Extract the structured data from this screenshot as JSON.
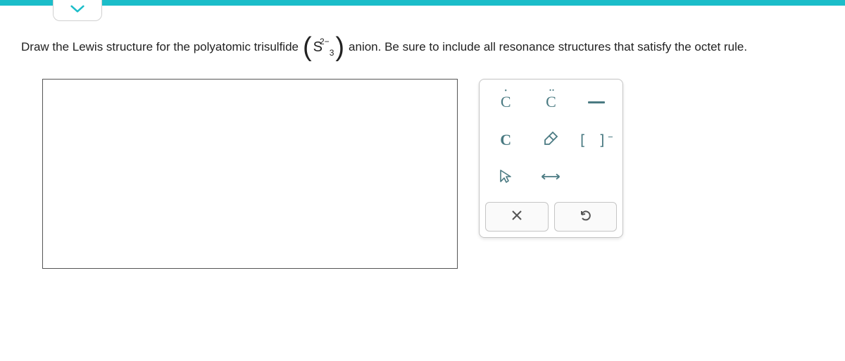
{
  "colors": {
    "accent": "#1BBDC9",
    "tool": "#4a7a82"
  },
  "question": {
    "text_before": "Draw the Lewis structure for the polyatomic trisulfide",
    "formula": {
      "element": "S",
      "subscript": "3",
      "superscript": "2−"
    },
    "text_after": "anion. Be sure to include all resonance structures that satisfy the octet rule."
  },
  "tools": {
    "lone_electron_label": "C",
    "two_electrons_label": "C",
    "generic_atom_label": "C",
    "bond": "—",
    "bracket": "[ ]",
    "bracket_sup": "−"
  }
}
